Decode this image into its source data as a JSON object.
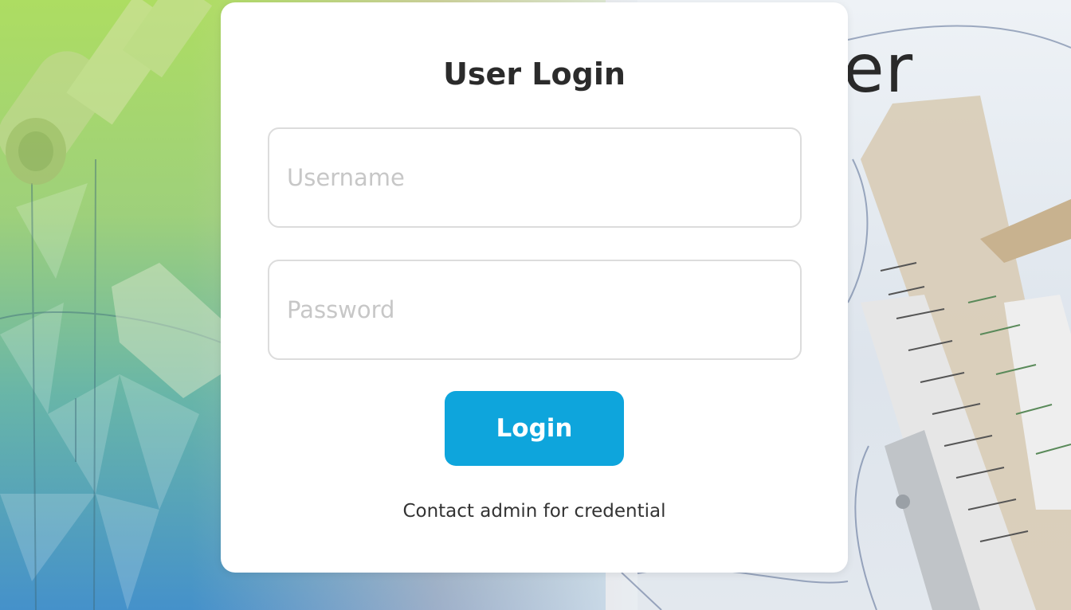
{
  "background": {
    "title_fragment": "er",
    "left_gradient": [
      "#aadc5a",
      "#3c8cc8"
    ],
    "right_tone": "#e3e8ee"
  },
  "login_card": {
    "title": "User Login",
    "username_placeholder": "Username",
    "username_value": "",
    "password_placeholder": "Password",
    "password_value": "",
    "login_label": "Login",
    "login_color": "#0ea5dc",
    "hint": "Contact admin for credential"
  }
}
